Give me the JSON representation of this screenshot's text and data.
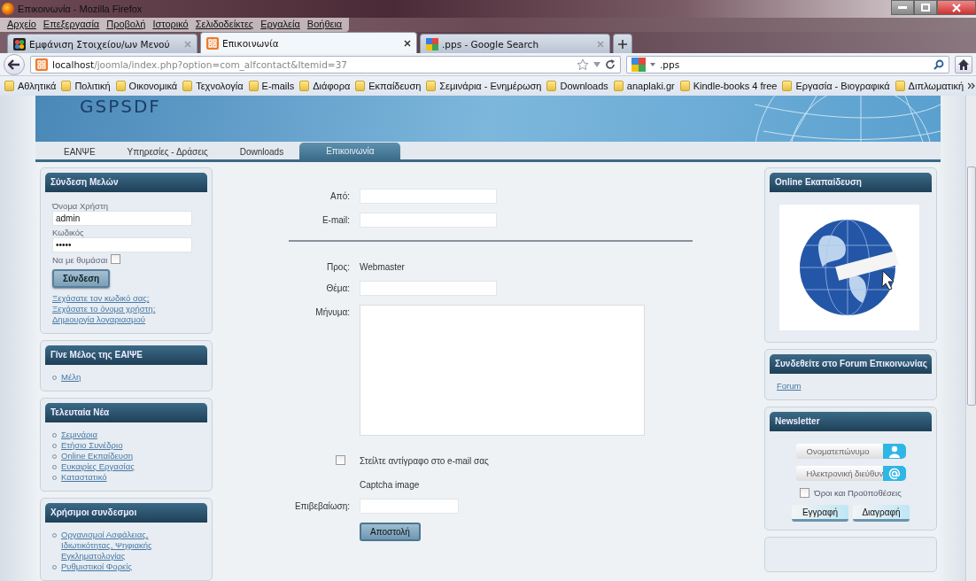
{
  "window": {
    "title": "Επικοινωνία - Mozilla Firefox"
  },
  "menu": [
    "Αρχείο",
    "Επεξεργασία",
    "Προβολή",
    "Ιστορικό",
    "Σελιδοδείκτες",
    "Εργαλεία",
    "Βοήθεια"
  ],
  "tabs": [
    {
      "label": "Εμφάνιση Στοιχείου/ων Μενού",
      "selected": false,
      "kind": "joomla"
    },
    {
      "label": "Επικοινωνία",
      "selected": true,
      "kind": "xampp"
    },
    {
      "label": ".pps - Google Search",
      "selected": false,
      "kind": "google"
    }
  ],
  "address": {
    "host": "localhost",
    "path": "/joomla/index.php?option=com_alfcontact&Itemid=37"
  },
  "search": {
    "value": ".pps"
  },
  "bookmarks": [
    "Αθλητικά",
    "Πολιτική",
    "Οικονομικά",
    "Τεχνολογία",
    "E-mails",
    "Διάφορα",
    "Εκπαίδευση",
    "Σεμινάρια - Ενημέρωση",
    "Downloads",
    "anaplaki.gr",
    "Kindle-books 4 free",
    "Εργασία - Βιογραφικά",
    "Διπλωματική"
  ],
  "site": {
    "logo": "GSPSDF",
    "nav": [
      {
        "label": "ΕΑΝΨΕ",
        "selected": false
      },
      {
        "label": "Υπηρεσίες - Δράσεις",
        "selected": false
      },
      {
        "label": "Downloads",
        "selected": false
      },
      {
        "label": "Επικοινωνία",
        "selected": true
      }
    ]
  },
  "login": {
    "title": "Σύνδεση Μελών",
    "username_label": "Όνομα Χρήστη",
    "username": "admin",
    "password_label": "Κωδικός",
    "password": "•••••",
    "remember_label": "Να με θυμάσαι",
    "remember": false,
    "button": "Σύνδεση",
    "links": [
      "Ξεχάσατε τον κωδικό σας;",
      "Ξεχάσατε το όνομα χρήστη;",
      "Δημιουργία λογαριασμού"
    ]
  },
  "left_modules": [
    {
      "title": "Γίνε Μέλος της ΕΑΙΨΕ",
      "items": [
        "Μέλη"
      ]
    },
    {
      "title": "Τελευταία Νέα",
      "items": [
        "Σεμινάρια",
        "Ετήσιο Συνέδριο",
        "Online Εκπαίδευση",
        "Ευκαιρίες Εργασίας",
        "Καταστατικό"
      ]
    },
    {
      "title": "Χρήσιμοι συνδεσμοι",
      "items": [
        "Οργανισμοί Ασφάλειας, Ιδιωτικότητας, Ψηφιακής Εγκληματολογίας",
        "Ρυθμιστικοί Φορείς"
      ]
    }
  ],
  "contact": {
    "from_label": "Από:",
    "email_label": "E-mail:",
    "to_label": "Προς:",
    "to_value": "Webmaster",
    "subject_label": "Θέμα:",
    "message_label": "Μήνυμα:",
    "copy_label": "Στείλτε αντίγραφο στο e-mail σας",
    "copy_checked": false,
    "captcha": "Captcha image",
    "confirm_label": "Επιβεβαίωση:",
    "submit": "Αποστολή"
  },
  "elearning": {
    "title": "Online Εκαπαίδευση"
  },
  "forum": {
    "title": "Συνδεθείτε στο Forum Επικοινωνίας",
    "link": "Forum"
  },
  "newsletter": {
    "title": "Newsletter",
    "name_placeholder": "Ονοματεπώνυμο",
    "email_placeholder": "Ηλεκτρονική διεύθυν",
    "terms_label": "Όροι και Προϋποθέσεις",
    "terms_checked": false,
    "subscribe": "Εγγραφή",
    "unsubscribe": "Διαγραφή"
  }
}
